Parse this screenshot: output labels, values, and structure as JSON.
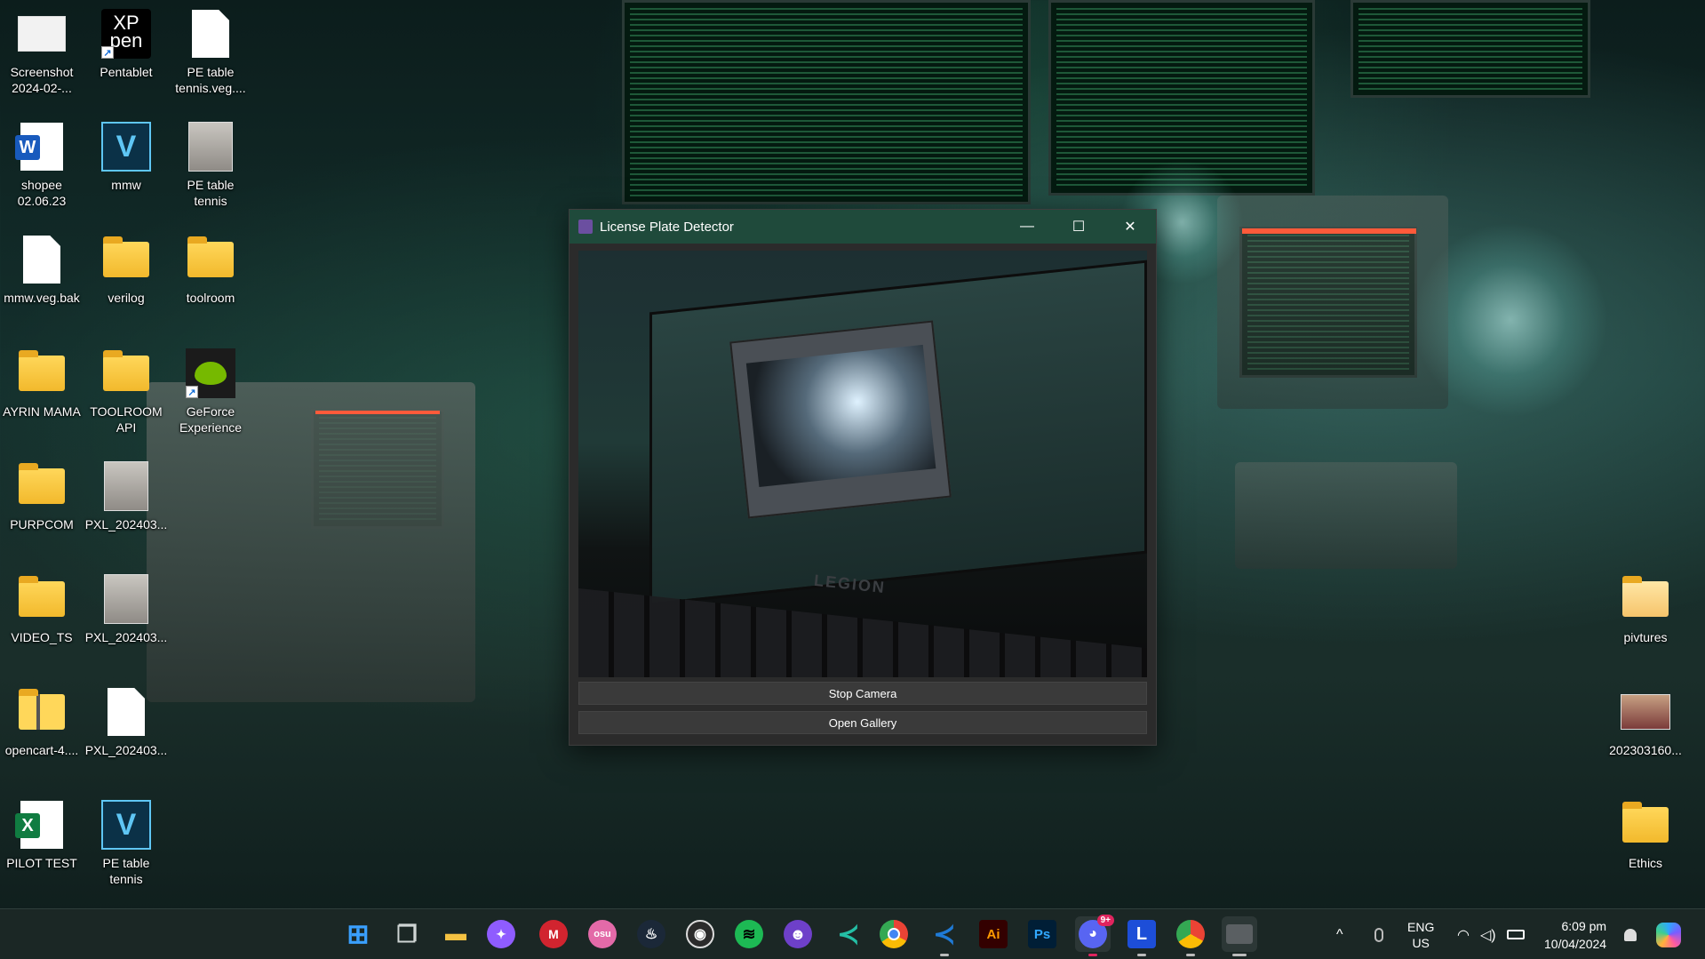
{
  "desktop": {
    "icons": [
      {
        "label": "Screenshot\n2024-02-...",
        "icon": "screenshot-file-icon"
      },
      {
        "label": "Pentablet",
        "icon": "xppen-app-icon",
        "glyph_text": "XP\npen"
      },
      {
        "label": "PE table\ntennis.veg....",
        "icon": "blank-file-icon"
      },
      {
        "label": "shopee\n02.06.23",
        "icon": "word-doc-icon",
        "glyph_text": "W"
      },
      {
        "label": "mmw",
        "icon": "vegas-app-icon",
        "glyph_text": "V"
      },
      {
        "label": "PE table\ntennis",
        "icon": "image-file-icon"
      },
      {
        "label": "mmw.veg.bak",
        "icon": "blank-file-icon"
      },
      {
        "label": "verilog",
        "icon": "folder-icon"
      },
      {
        "label": "toolroom",
        "icon": "folder-icon"
      },
      {
        "label": "AYRIN MAMA",
        "icon": "folder-icon"
      },
      {
        "label": "TOOLROOM\nAPI",
        "icon": "folder-icon"
      },
      {
        "label": "GeForce\nExperience",
        "icon": "nvidia-app-icon"
      },
      {
        "label": "PURPCOM",
        "icon": "folder-icon"
      },
      {
        "label": "PXL_202403...",
        "icon": "vlc-video-icon"
      },
      {
        "label": "VIDEO_TS",
        "icon": "folder-icon"
      },
      {
        "label": "PXL_202403...",
        "icon": "vlc-video-icon"
      },
      {
        "label": "opencart-4....",
        "icon": "zip-folder-icon"
      },
      {
        "label": "PXL_202403...",
        "icon": "blank-file-icon"
      },
      {
        "label": "PILOT TEST",
        "icon": "excel-file-icon",
        "glyph_text": "X"
      },
      {
        "label": "PE table\ntennis",
        "icon": "vegas-app-icon",
        "glyph_text": "V"
      },
      {
        "label": "pivtures",
        "icon": "folder-icon"
      },
      {
        "label": "202303160...",
        "icon": "image-file-icon"
      },
      {
        "label": "Ethics",
        "icon": "folder-icon"
      }
    ]
  },
  "window": {
    "title": "License Plate Detector",
    "minimize_glyph": "—",
    "maximize_glyph": "☐",
    "close_glyph": "✕",
    "camera_brand_text": "LEGION",
    "buttons": {
      "stop_camera": "Stop Camera",
      "open_gallery": "Open Gallery"
    }
  },
  "taskbar": {
    "apps": [
      {
        "name": "start",
        "glyph": "⊞",
        "color": "#3aa0ff"
      },
      {
        "name": "task-view",
        "glyph": "❐",
        "color": "#cfd5d4"
      },
      {
        "name": "file-explorer",
        "glyph": "▬",
        "color": "#f5c242"
      },
      {
        "name": "messenger",
        "glyph": "✦",
        "color": "#8f5cff"
      },
      {
        "name": "mcafee",
        "glyph": "M",
        "color": "#d1242f"
      },
      {
        "name": "osu",
        "glyph": "osu",
        "color": "#e36aa8"
      },
      {
        "name": "steam",
        "glyph": "♨",
        "color": "#1b2838"
      },
      {
        "name": "obs",
        "glyph": "◉",
        "color": "#2b2b2b"
      },
      {
        "name": "spotify",
        "glyph": "≋",
        "color": "#1db954"
      },
      {
        "name": "github",
        "glyph": "☻",
        "color": "#6e40c9"
      },
      {
        "name": "vs-code-insiders",
        "glyph": "≺",
        "color": "#24bfa5"
      },
      {
        "name": "chrome",
        "glyph": "◎",
        "color": "#e8453c"
      },
      {
        "name": "vs-code",
        "glyph": "≺",
        "color": "#1f7ad6"
      },
      {
        "name": "illustrator",
        "glyph": "Ai",
        "color": "#330000"
      },
      {
        "name": "photoshop",
        "glyph": "Ps",
        "color": "#001e36"
      },
      {
        "name": "discord",
        "glyph": "◕",
        "color": "#5865f2",
        "badge": "9+"
      },
      {
        "name": "lunar-client",
        "glyph": "L",
        "color": "#1d4ed8"
      },
      {
        "name": "chrome-profile",
        "glyph": "◎",
        "color": "#e8453c"
      },
      {
        "name": "camera-app",
        "glyph": "▣",
        "color": "#5a5f62"
      }
    ],
    "tray": {
      "chevron": "^",
      "language": "ENG",
      "region": "US",
      "time": "6:09 pm",
      "date": "10/04/2024"
    }
  }
}
